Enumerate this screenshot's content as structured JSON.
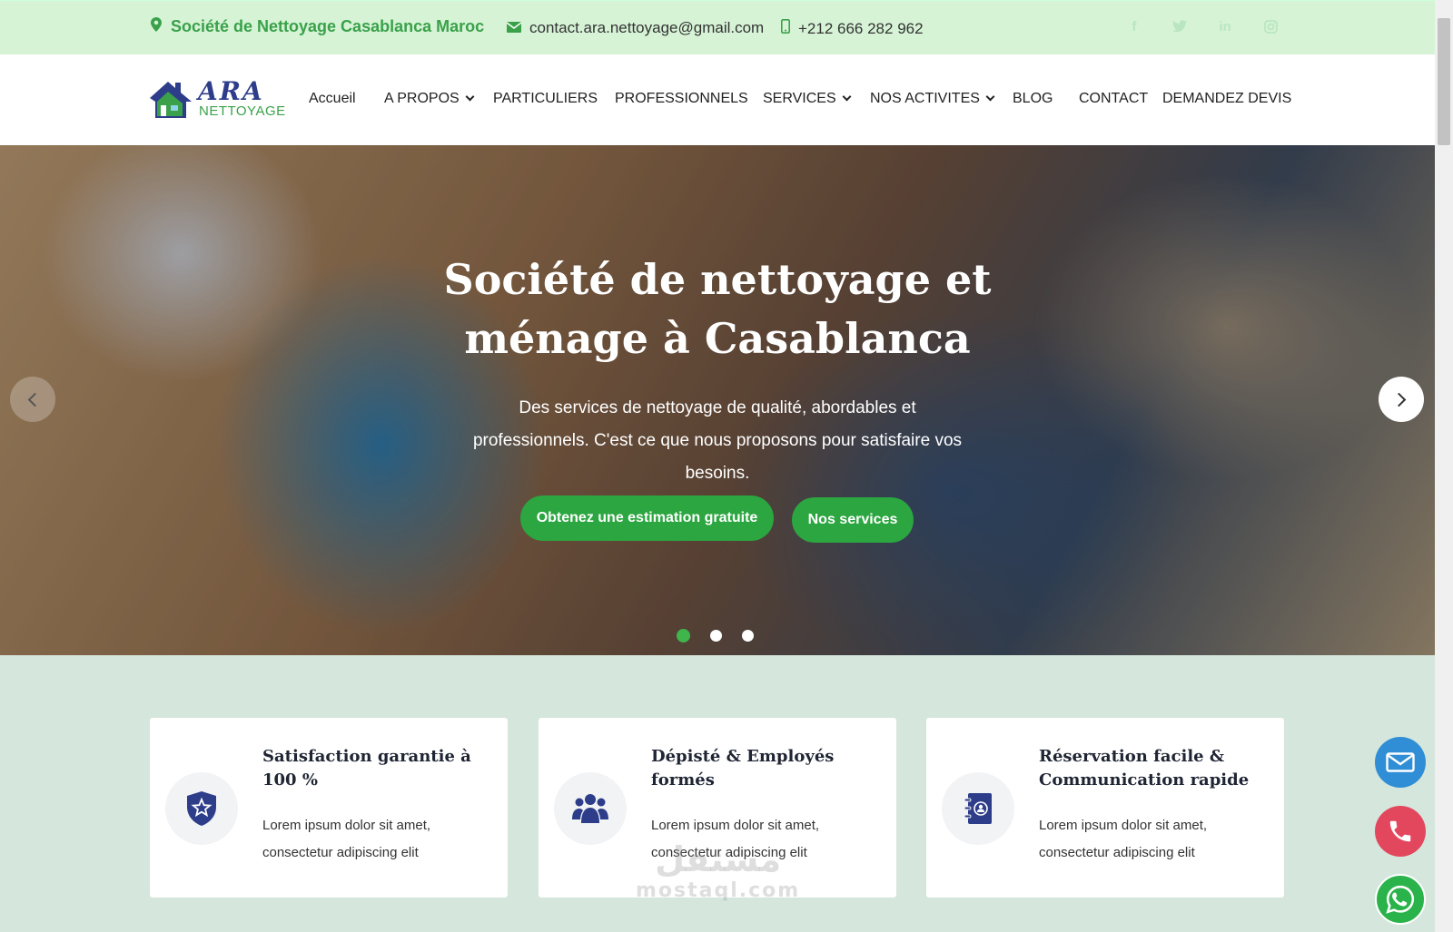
{
  "topbar": {
    "location": "Société de Nettoyage Casablanca Maroc",
    "email": "contact.ara.nettoyage@gmail.com",
    "phone": "+212 666 282 962",
    "socials": [
      "facebook-icon",
      "twitter-icon",
      "linkedin-icon",
      "instagram-icon"
    ],
    "social_glyphs": [
      "f",
      "t",
      "in",
      "◎"
    ]
  },
  "nav": {
    "logo_text": "ARA",
    "logo_sub": "NETTOYAGE",
    "items": [
      {
        "label": "Accueil",
        "dropdown": false
      },
      {
        "label": "A PROPOS",
        "dropdown": true
      },
      {
        "label": "PARTICULIERS",
        "dropdown": false
      },
      {
        "label": "PROFESSIONNELS",
        "dropdown": false
      },
      {
        "label": "SERVICES",
        "dropdown": true
      },
      {
        "label": "NOS ACTIVITES",
        "dropdown": true
      },
      {
        "label": "BLOG",
        "dropdown": false
      },
      {
        "label": "CONTACT",
        "dropdown": false
      },
      {
        "label": "DEMANDEZ DEVIS",
        "dropdown": false
      }
    ]
  },
  "hero": {
    "title": "Société de nettoyage et ménage à Casablanca",
    "text": "Des services de nettoyage de qualité, abordables et professionnels. C'est ce que nous proposons pour satisfaire vos besoins.",
    "btn_primary": "Obtenez une estimation gratuite",
    "btn_secondary": "Nos services",
    "slides": 3,
    "active_slide": 1
  },
  "features": [
    {
      "icon": "shield-star-icon",
      "title": "Satisfaction garantie à 100 %",
      "text": "Lorem ipsum dolor sit amet, consectetur adipiscing elit"
    },
    {
      "icon": "users-icon",
      "title": "Dépisté & Employés formés",
      "text": "Lorem ipsum dolor sit amet, consectetur adipiscing elit"
    },
    {
      "icon": "contact-book-icon",
      "title": "Réservation facile & Communication rapide",
      "text": "Lorem ipsum dolor sit amet, consectetur adipiscing elit"
    }
  ],
  "watermark": {
    "arabic": "مستقل",
    "latin": "mostaql.com"
  },
  "colors": {
    "accent_green": "#2ba640",
    "brand_blue": "#2d3d8a",
    "topbar_bg": "#d6f3d6",
    "section_bg": "#d5e6dc"
  }
}
